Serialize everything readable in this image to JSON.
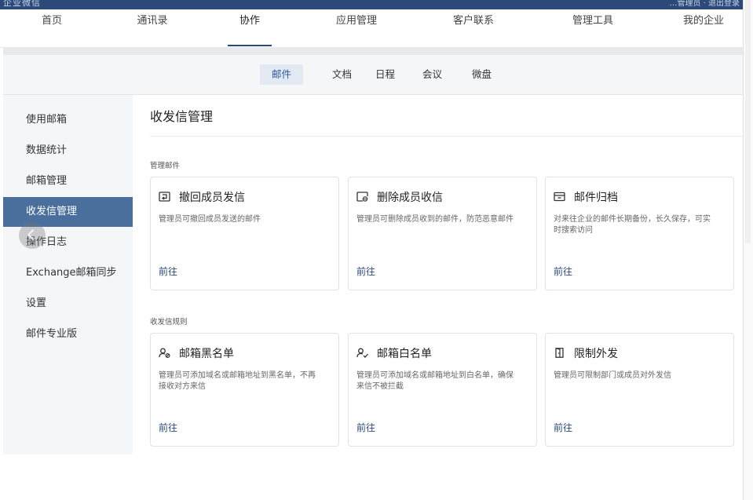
{
  "topbar": {
    "logo_text": "企业微信",
    "user_text": "…管理员 · 退出登录"
  },
  "nav": [
    {
      "label": "首页",
      "active": false
    },
    {
      "label": "通讯录",
      "active": false
    },
    {
      "label": "协作",
      "active": true
    },
    {
      "label": "应用管理",
      "active": false
    },
    {
      "label": "客户联系",
      "active": false
    },
    {
      "label": "管理工具",
      "active": false
    },
    {
      "label": "我的企业",
      "active": false
    }
  ],
  "subtabs": [
    {
      "label": "邮件",
      "active": true
    },
    {
      "label": "文档",
      "active": false
    },
    {
      "label": "日程",
      "active": false
    },
    {
      "label": "会议",
      "active": false
    },
    {
      "label": "微盘",
      "active": false
    }
  ],
  "sidebar": [
    {
      "label": "使用邮箱",
      "active": false
    },
    {
      "label": "数据统计",
      "active": false
    },
    {
      "label": "邮箱管理",
      "active": false
    },
    {
      "label": "收发信管理",
      "active": true
    },
    {
      "label": "操作日志",
      "active": false
    },
    {
      "label": "Exchange邮箱同步",
      "active": false
    },
    {
      "label": "设置",
      "active": false
    },
    {
      "label": "邮件专业版",
      "active": false
    }
  ],
  "page_title": "收发信管理",
  "sections": [
    {
      "title": "管理邮件",
      "cards": [
        {
          "title": "撤回成员发信",
          "icon": "recall-icon",
          "desc": "管理员可撤回成员发送的邮件",
          "link": "前往"
        },
        {
          "title": "删除成员收信",
          "icon": "delete-mail-icon",
          "desc": "管理员可删除成员收到的邮件，防范恶意邮件",
          "link": "前往"
        },
        {
          "title": "邮件归档",
          "icon": "archive-icon",
          "desc": "对来往企业的邮件长期备份，长久保存，可实时搜索访问",
          "link": "前往"
        }
      ]
    },
    {
      "title": "收发信规则",
      "cards": [
        {
          "title": "邮箱黑名单",
          "icon": "user-block-icon",
          "desc": "管理员可添加域名或邮箱地址到黑名单，不再接收对方来信",
          "link": "前往"
        },
        {
          "title": "邮箱白名单",
          "icon": "user-check-icon",
          "desc": "管理员可添加域名或邮箱地址到白名单，确保来信不被拦截",
          "link": "前往"
        },
        {
          "title": "限制外发",
          "icon": "door-exit-icon",
          "desc": "管理员可限制部门或成员对外发信",
          "link": "前往"
        }
      ]
    }
  ],
  "colors": {
    "brand": "#2b4a7a",
    "sidebar_active": "#4a6f9c",
    "link": "#2b4a7a"
  }
}
